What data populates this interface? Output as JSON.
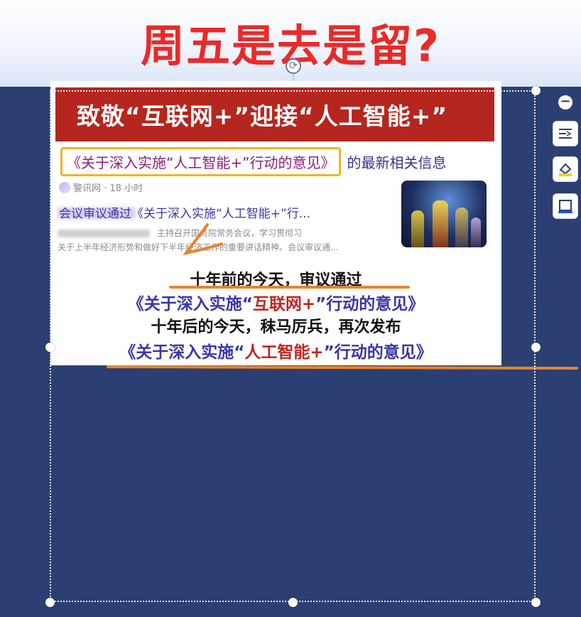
{
  "header": {
    "title": "周五是去是留?"
  },
  "slide": {
    "banner": "致敬“互联网+”迎接“人工智能+”",
    "search": {
      "policy_chip": "《关于深入实施“人工智能+”行动的意见》",
      "suffix": "的最新相关信息"
    },
    "news": {
      "source": "警讯网 · 18 小时",
      "title_visible": "会议审议通过《关于深入实施“人工智能+”行...",
      "snippet_line1": "主持召开国务院常务会议，学习贯彻习",
      "snippet_line2": "关于上半年经济形势和做好下半年经济工作的重要讲话精神。会议审议通..."
    },
    "captions": {
      "line1": "十年前的今天，审议通过",
      "line2_prefix": "《关于深入实施“",
      "line2_highlight": "互联网+",
      "line2_suffix": "”行动的意见》",
      "line3": "十年后的今天，秣马厉兵，再次发布",
      "line4_prefix": "《关于深入实施“",
      "line4_highlight": "人工智能+",
      "line4_suffix": "”行动的意见》"
    }
  },
  "toolbar": {
    "items": [
      {
        "name": "collapse-icon",
        "glyph": "−"
      },
      {
        "name": "crop-text-icon"
      },
      {
        "name": "fill-icon"
      },
      {
        "name": "frame-icon"
      }
    ]
  },
  "colors": {
    "headline_red": "#ea2a2a",
    "banner_red": "#b5261e",
    "stage_blue": "#2b3f72",
    "annotation_orange": "#e8832a",
    "chip_border": "#f0b429"
  }
}
